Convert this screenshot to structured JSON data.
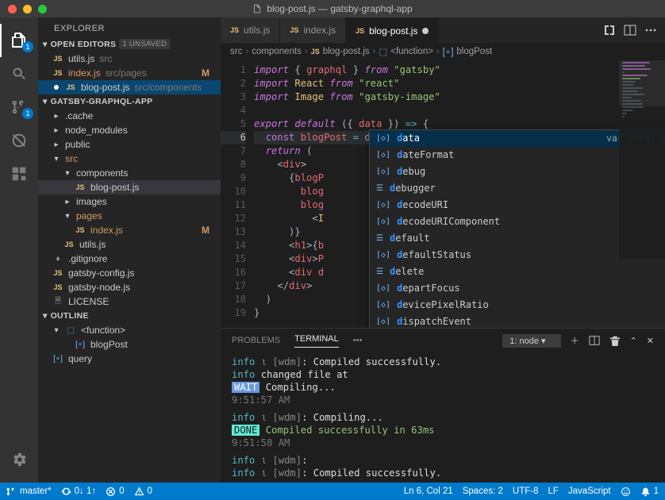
{
  "window": {
    "title": "blog-post.js — gatsby-graphql-app"
  },
  "activity": {
    "explorer_badge": "1",
    "scm_badge": "1"
  },
  "sidebar": {
    "title": "EXPLORER",
    "openEditors": {
      "label": "OPEN EDITORS",
      "unsaved": "1 UNSAVED"
    },
    "openItems": [
      {
        "name": "utils.js",
        "path": "src",
        "mod": ""
      },
      {
        "name": "index.js",
        "path": "src/pages",
        "mod": "M"
      },
      {
        "name": "blog-post.js",
        "path": "src/components",
        "mod": ""
      }
    ],
    "project": {
      "label": "GATSBY-GRAPHQL-APP"
    },
    "tree": {
      "folders_top": [
        ".cache",
        "node_modules",
        "public"
      ],
      "src": "src",
      "components": "components",
      "blogpost": "blog-post.js",
      "images": "images",
      "pages": "pages",
      "indexjs": "index.js",
      "indexjs_mod": "M",
      "utilsjs": "utils.js",
      "gitignore": ".gitignore",
      "gatsbyconfig": "gatsby-config.js",
      "gatsbynode": "gatsby-node.js",
      "license": "LICENSE"
    },
    "outline": {
      "label": "OUTLINE",
      "items": [
        "<function>",
        "blogPost",
        "query"
      ]
    }
  },
  "tabs": [
    {
      "label": "utils.js",
      "active": false,
      "dirty": false
    },
    {
      "label": "index.js",
      "active": false,
      "dirty": false
    },
    {
      "label": "blog-post.js",
      "active": true,
      "dirty": true
    }
  ],
  "breadcrumb": [
    "src",
    "components",
    "blog-post.js",
    "<function>",
    "blogPost"
  ],
  "code": {
    "lines": 19
  },
  "suggest": {
    "items": [
      "data",
      "dateFormat",
      "debug",
      "debugger",
      "decodeURI",
      "decodeURIComponent",
      "default",
      "defaultStatus",
      "delete",
      "departFocus",
      "devicePixelRatio",
      "dispatchEvent"
    ],
    "detail": "var data: any"
  },
  "panel": {
    "tabs": [
      "PROBLEMS",
      "TERMINAL",
      "•••"
    ],
    "term_select": "1: node",
    "lines": {
      "l1a": "info",
      "l1b": "[wdm]",
      "l1c": ": Compiled successfully.",
      "l2a": "info",
      "l2b": "changed file at",
      "l3a": "WAIT",
      "l3b": "Compiling...",
      "l3t": "9:51:57 AM",
      "l4a": "info",
      "l4b": "[wdm]",
      "l4c": ": Compiling...",
      "l5a": "DONE",
      "l5b": "Compiled successfully in 63ms",
      "l5t": "9:51:58 AM",
      "l6a": "info",
      "l6b": "[wdm]",
      "l6c": ":",
      "l7a": "info",
      "l7b": "[wdm]",
      "l7c": ": Compiled successfully."
    }
  },
  "status": {
    "branch": "master*",
    "sync": "0↓ 1↑",
    "errors": "0",
    "warnings": "0",
    "lncol": "Ln 6, Col 21",
    "spaces": "Spaces: 2",
    "encoding": "UTF-8",
    "eol": "LF",
    "lang": "JavaScript",
    "bell": "1"
  }
}
